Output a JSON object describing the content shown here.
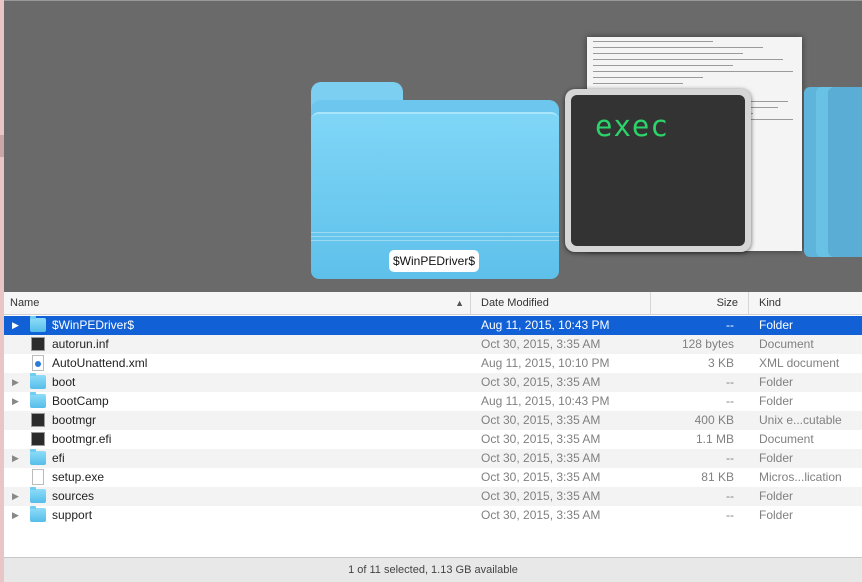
{
  "coverflow": {
    "folder_label": "$WinPEDriver$",
    "terminal_text": "exec"
  },
  "columns": {
    "name": "Name",
    "date": "Date Modified",
    "size": "Size",
    "kind": "Kind"
  },
  "rows": [
    {
      "disclosure": "▶",
      "icon": "folder-icon",
      "name": "$WinPEDriver$",
      "date": "Aug 11, 2015, 10:43 PM",
      "size": "--",
      "kind": "Folder"
    },
    {
      "disclosure": "",
      "icon": "exec-file-icon",
      "name": "autorun.inf",
      "date": "Oct 30, 2015, 3:35 AM",
      "size": "128 bytes",
      "kind": "Document"
    },
    {
      "disclosure": "",
      "icon": "xml-file-icon",
      "name": "AutoUnattend.xml",
      "date": "Aug 11, 2015, 10:10 PM",
      "size": "3 KB",
      "kind": "XML document"
    },
    {
      "disclosure": "▶",
      "icon": "folder-icon",
      "name": "boot",
      "date": "Oct 30, 2015, 3:35 AM",
      "size": "--",
      "kind": "Folder"
    },
    {
      "disclosure": "▶",
      "icon": "folder-icon",
      "name": "BootCamp",
      "date": "Aug 11, 2015, 10:43 PM",
      "size": "--",
      "kind": "Folder"
    },
    {
      "disclosure": "",
      "icon": "exec-file-icon",
      "name": "bootmgr",
      "date": "Oct 30, 2015, 3:35 AM",
      "size": "400 KB",
      "kind": "Unix e...cutable"
    },
    {
      "disclosure": "",
      "icon": "exec-file-icon",
      "name": "bootmgr.efi",
      "date": "Oct 30, 2015, 3:35 AM",
      "size": "1.1 MB",
      "kind": "Document"
    },
    {
      "disclosure": "▶",
      "icon": "folder-icon",
      "name": "efi",
      "date": "Oct 30, 2015, 3:35 AM",
      "size": "--",
      "kind": "Folder"
    },
    {
      "disclosure": "",
      "icon": "document-icon",
      "name": "setup.exe",
      "date": "Oct 30, 2015, 3:35 AM",
      "size": "81 KB",
      "kind": "Micros...lication"
    },
    {
      "disclosure": "▶",
      "icon": "folder-icon",
      "name": "sources",
      "date": "Oct 30, 2015, 3:35 AM",
      "size": "--",
      "kind": "Folder"
    },
    {
      "disclosure": "▶",
      "icon": "folder-icon",
      "name": "support",
      "date": "Oct 30, 2015, 3:35 AM",
      "size": "--",
      "kind": "Folder"
    }
  ],
  "selected_row": 0,
  "status": {
    "text": "1 of 11 selected, 1.13 GB available"
  },
  "colors": {
    "selection": "#1160d6",
    "coverflow_background": "#6a6a6a",
    "folder_blue": "#5ec0ea",
    "terminal_green": "#2bd46a"
  }
}
